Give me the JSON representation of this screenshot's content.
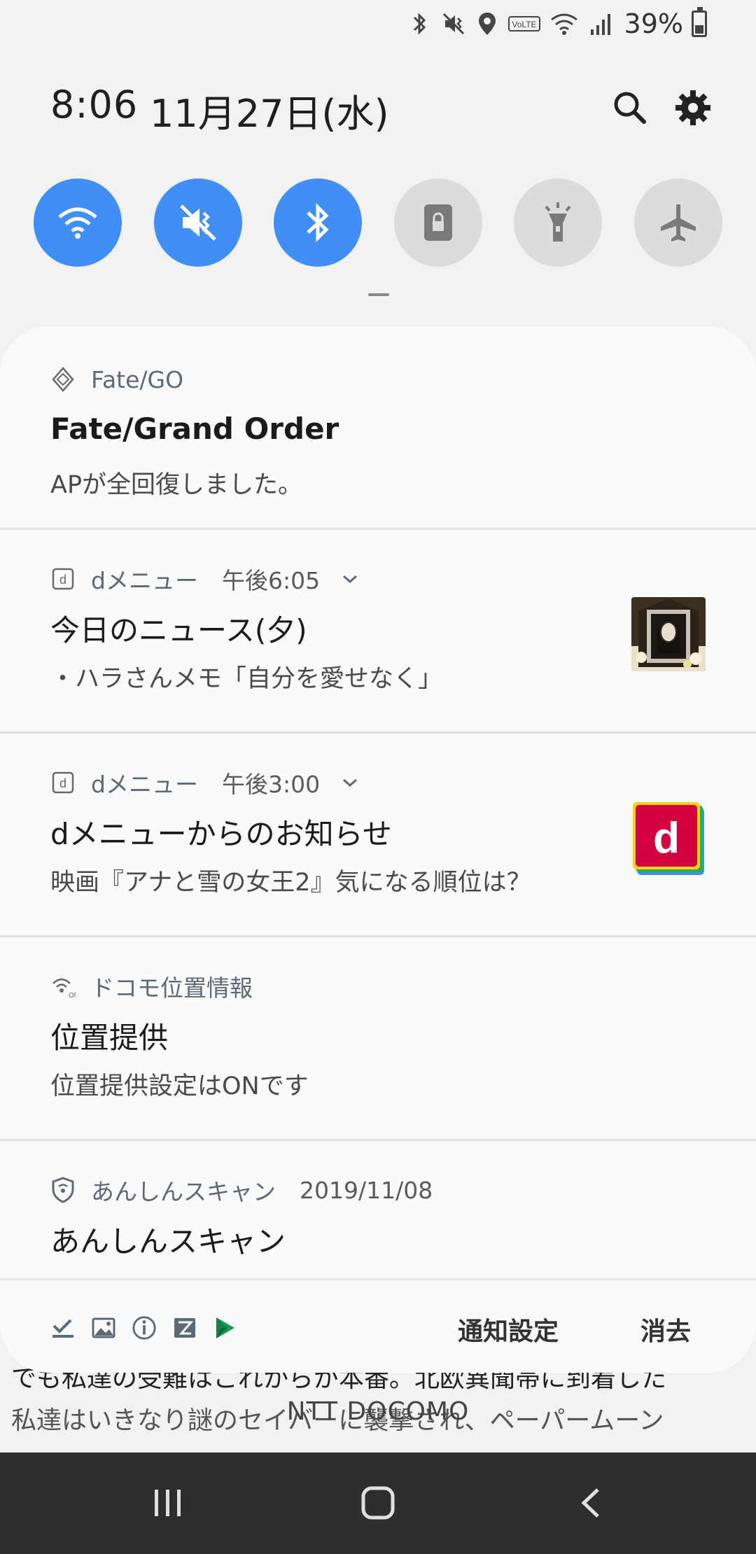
{
  "status_bar": {
    "battery_percent": "39%",
    "battery_level": 0.39,
    "icons": [
      "bluetooth-icon",
      "vibrate-icon",
      "location-icon",
      "volte-icon",
      "wifi-icon",
      "signal-icon",
      "battery-icon"
    ]
  },
  "header": {
    "time": "8:06",
    "date": "11月27日(水)",
    "search_icon": "search-icon",
    "settings_icon": "gear-icon"
  },
  "quick_toggles": [
    {
      "name": "wifi",
      "state": "on"
    },
    {
      "name": "vibrate",
      "state": "on"
    },
    {
      "name": "bluetooth",
      "state": "on"
    },
    {
      "name": "screen-lock",
      "state": "off"
    },
    {
      "name": "flashlight",
      "state": "off"
    },
    {
      "name": "airplane-mode",
      "state": "off"
    }
  ],
  "notifications": [
    {
      "app": "Fate/GO",
      "time": "",
      "title": "Fate/Grand Order",
      "body": "APが全回復しました。"
    },
    {
      "app": "dメニュー",
      "time": "午後6:05",
      "title": "今日のニュース(夕)",
      "body": "・ハラさんメモ「自分を愛せなく」"
    },
    {
      "app": "dメニュー",
      "time": "午後3:00",
      "title": "dメニューからのお知らせ",
      "body": "映画『アナと雪の女王2』気になる順位は？"
    },
    {
      "app": "ドコモ位置情報",
      "time": "",
      "title": "位置提供",
      "body": "位置提供設定はONです"
    },
    {
      "app": "あんしんスキャン",
      "time": "2019/11/08",
      "title": "あんしんスキャン",
      "body": ""
    }
  ],
  "footer": {
    "notification_settings_label": "通知設定",
    "clear_label": "消去"
  },
  "background": {
    "line1": "でも私達の受難はこれからが本番。北欧異聞帯に到着した",
    "line2": "私達はいきなり謎のセイバーに襲撃され、ペーパームーン"
  },
  "carrier": "NTT DOCOMO",
  "colors": {
    "accent": "#3f8ff7",
    "toggle_off": "#dcdcdc",
    "panel": "#fafafa",
    "navbar": "#2e2e2e"
  }
}
